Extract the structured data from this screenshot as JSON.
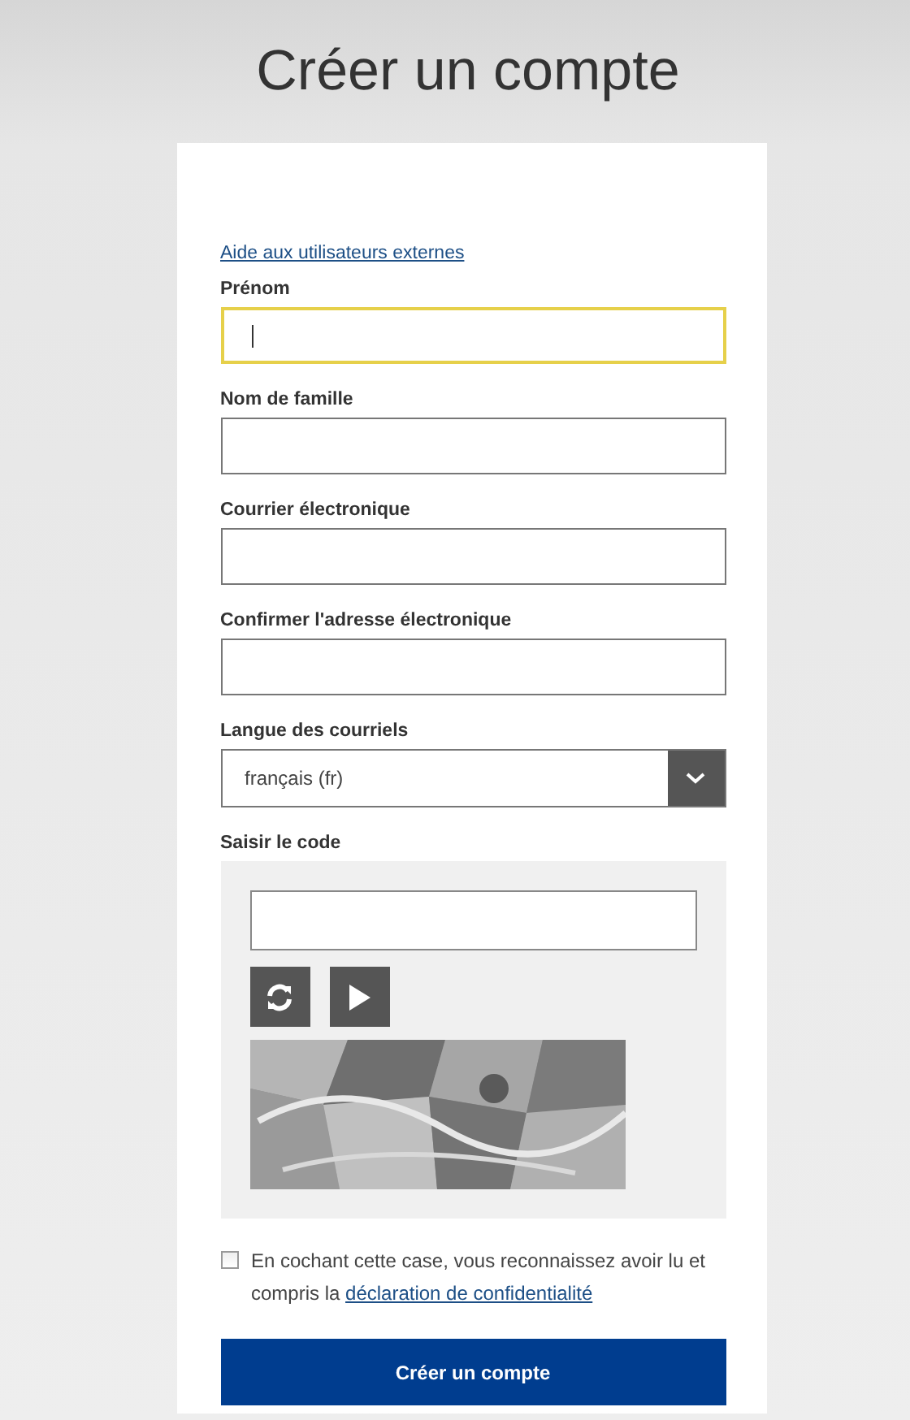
{
  "page_title": "Créer un compte",
  "help_link": "Aide aux utilisateurs externes",
  "fields": [
    {
      "label": "Prénom",
      "kind": "text",
      "focused": true
    },
    {
      "label": "Nom de famille",
      "kind": "text",
      "focused": false
    },
    {
      "label": "Courrier électronique",
      "kind": "text",
      "focused": false
    },
    {
      "label": "Confirmer l'adresse électronique",
      "kind": "text",
      "focused": false
    },
    {
      "label": "Langue des courriels",
      "kind": "select",
      "value": "français (fr)"
    }
  ],
  "captcha": {
    "label": "Saisir le code"
  },
  "consent": {
    "checked": false,
    "text": "En cochant cette case, vous reconnaissez avoir lu et compris la ",
    "link": "déclaration de confidentialité"
  },
  "submit": "Créer un compte"
}
